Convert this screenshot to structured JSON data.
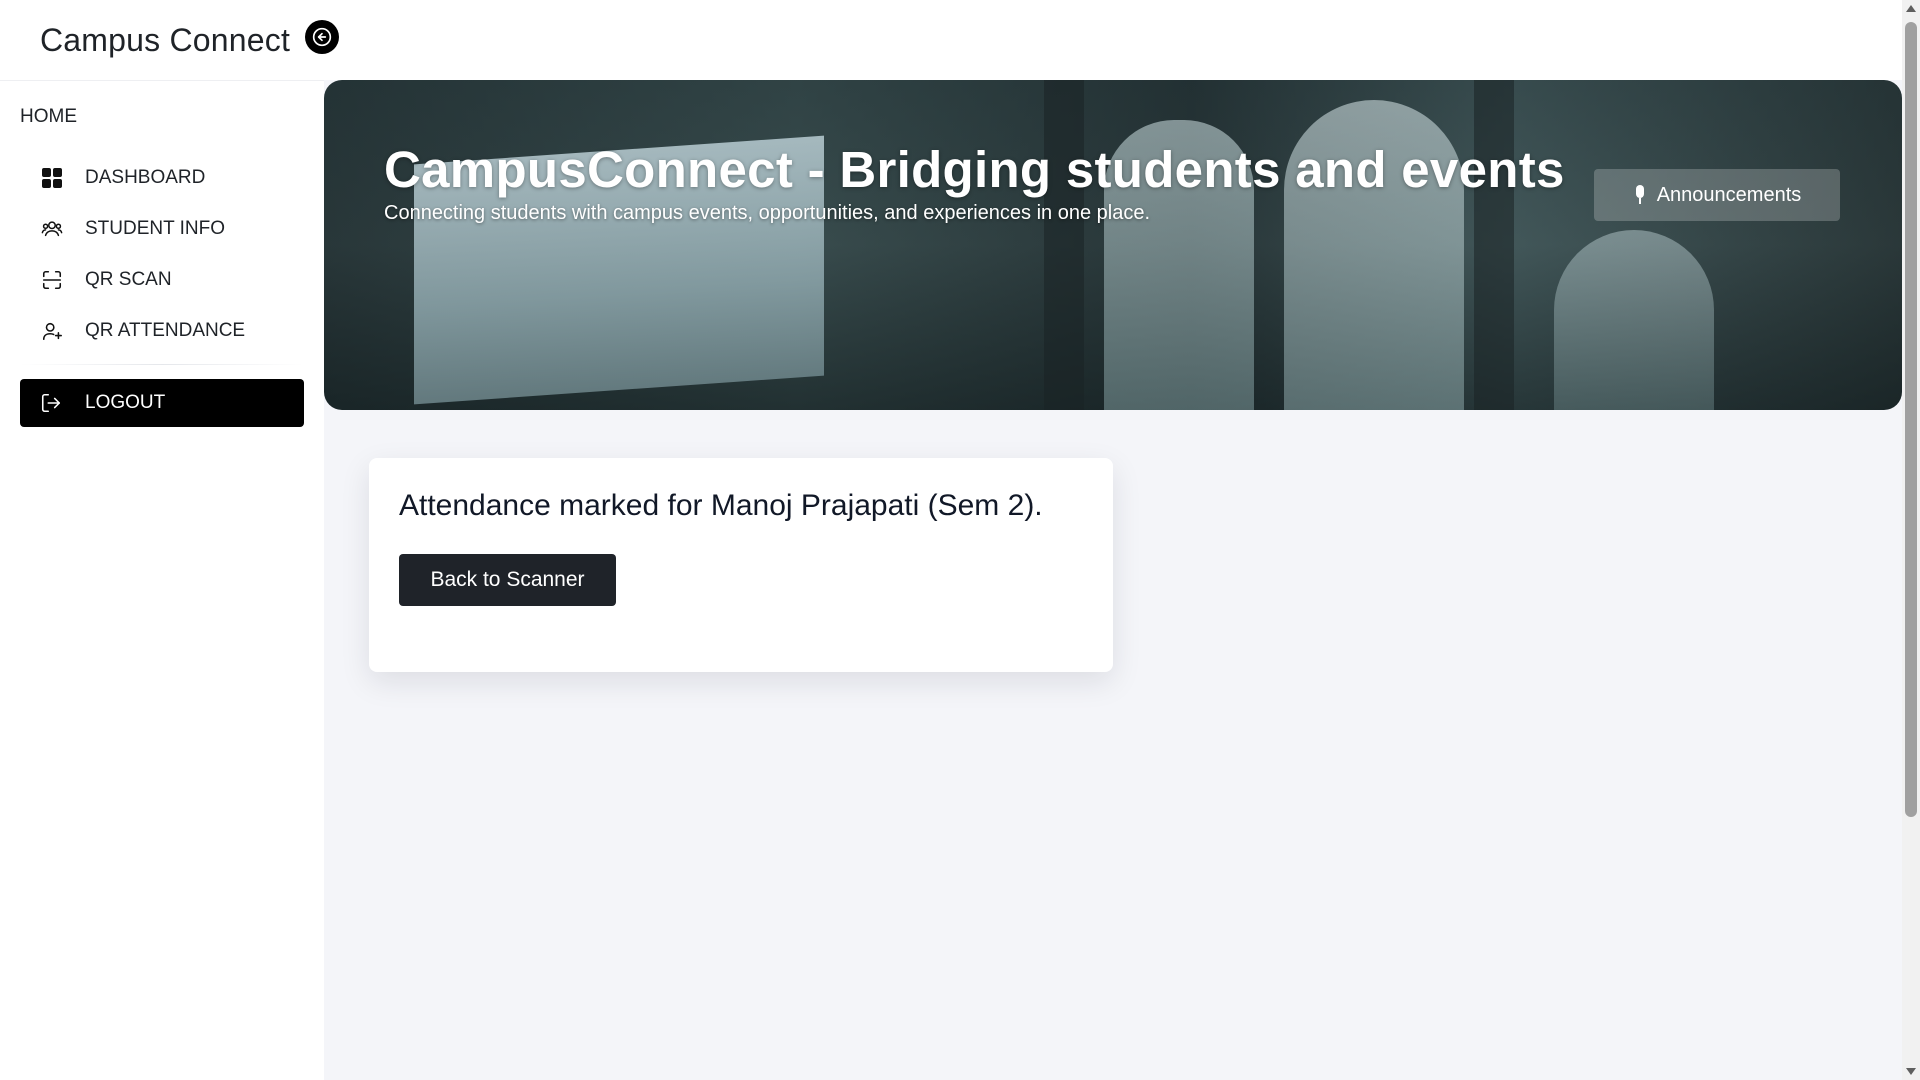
{
  "sidebar": {
    "brand_title": "Campus Connect",
    "section_label": "HOME",
    "items": [
      {
        "label": "DASHBOARD",
        "icon": "dashboard-grid-icon"
      },
      {
        "label": "STUDENT INFO",
        "icon": "users-icon"
      },
      {
        "label": "QR SCAN",
        "icon": "scan-icon"
      },
      {
        "label": "QR ATTENDANCE",
        "icon": "user-plus-icon"
      }
    ],
    "logout_label": "LOGOUT",
    "logout_icon": "logout-icon",
    "collapse_icon": "arrow-left-icon"
  },
  "hero": {
    "title": "CampusConnect - Bridging students and events",
    "subtitle": "Connecting students with campus events, opportunities, and experiences in one place.",
    "announcements_label": "Announcements",
    "announcements_icon": "microphone-icon"
  },
  "result_card": {
    "message": "Attendance marked for Manoj Prajapati (Sem 2).",
    "back_button_label": "Back to Scanner"
  },
  "colors": {
    "primary": "#000000",
    "button_dark": "#1f2329",
    "main_bg": "#f4f5f9"
  }
}
